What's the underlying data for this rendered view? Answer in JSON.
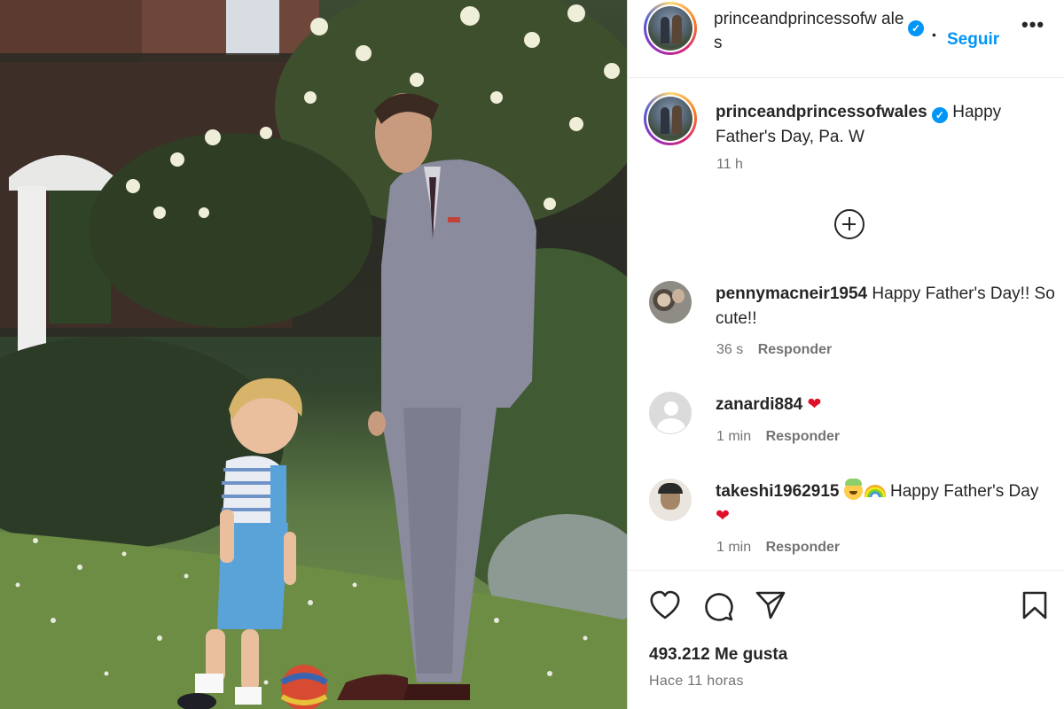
{
  "post": {
    "username": "princeandprincessofwales",
    "username_wrapped": "princeandprincessofw ales",
    "follow_label": "Seguir",
    "more_label": "•••",
    "caption_text": "Happy Father's Day, Pa. W",
    "caption_time": "11 h",
    "verified_mark": "✓"
  },
  "comments": [
    {
      "username": "pennymacneir1954",
      "text": "Happy Father's Day!! So cute!!",
      "time": "36 s",
      "reply_label": "Responder"
    },
    {
      "username": "zanardi884",
      "text": "❤",
      "time": "1 min",
      "reply_label": "Responder"
    },
    {
      "username": "takeshi1962915",
      "text": "Happy Father's Day",
      "heart": "❤",
      "time": "1 min",
      "reply_label": "Responder"
    }
  ],
  "actions": {
    "icons": [
      "heart-icon",
      "comment-icon",
      "share-icon",
      "bookmark-icon"
    ],
    "likes": "493.212 Me gusta",
    "posted_ago": "Hace 11 horas"
  },
  "colors": {
    "link_blue": "#0095f6",
    "verified_blue": "#0095f6",
    "heart_red": "#e0102b",
    "text_primary": "#262626",
    "text_secondary": "#737373"
  }
}
